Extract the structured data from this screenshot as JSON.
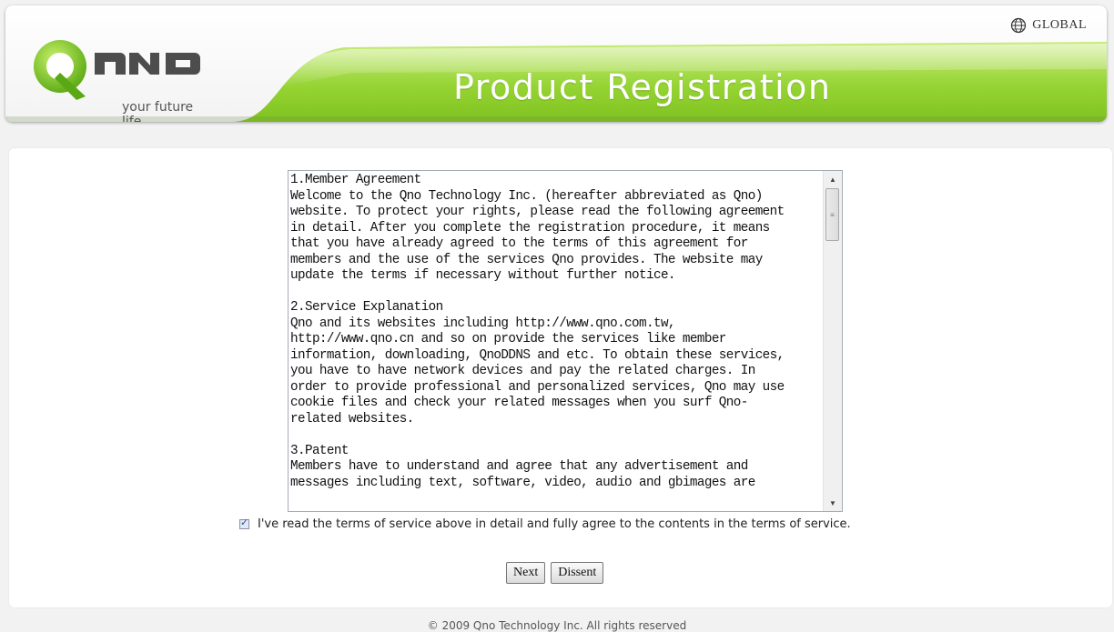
{
  "header": {
    "logo_text": "QNO",
    "logo_tagline": "your future life",
    "title": "Product Registration",
    "global_label": "GLOBAL"
  },
  "terms": {
    "text": "1.Member Agreement\nWelcome to the Qno Technology Inc. (hereafter abbreviated as Qno)\nwebsite. To protect your rights, please read the following agreement\nin detail. After you complete the registration procedure, it means\nthat you have already agreed to the terms of this agreement for\nmembers and the use of the services Qno provides. The website may\nupdate the terms if necessary without further notice.\n\n2.Service Explanation\nQno and its websites including http://www.qno.com.tw,\nhttp://www.qno.cn and so on provide the services like member\ninformation, downloading, QnoDDNS and etc. To obtain these services,\nyou have to have network devices and pay the related charges. In\norder to provide professional and personalized services, Qno may use\ncookie files and check your related messages when you surf Qno-\nrelated websites.\n\n3.Patent\nMembers have to understand and agree that any advertisement and\nmessages including text, software, video, audio and gbimages are"
  },
  "agreement": {
    "label": "I've read the terms of service above in detail and fully agree to the contents in the terms of service.",
    "checked": true
  },
  "buttons": {
    "next": "Next",
    "dissent": "Dissent"
  },
  "footer": {
    "copyright": "© 2009 Qno Technology Inc. All rights reserved"
  },
  "colors": {
    "brand_green": "#8ccc2a",
    "logo_dark": "#4a4a4a"
  }
}
